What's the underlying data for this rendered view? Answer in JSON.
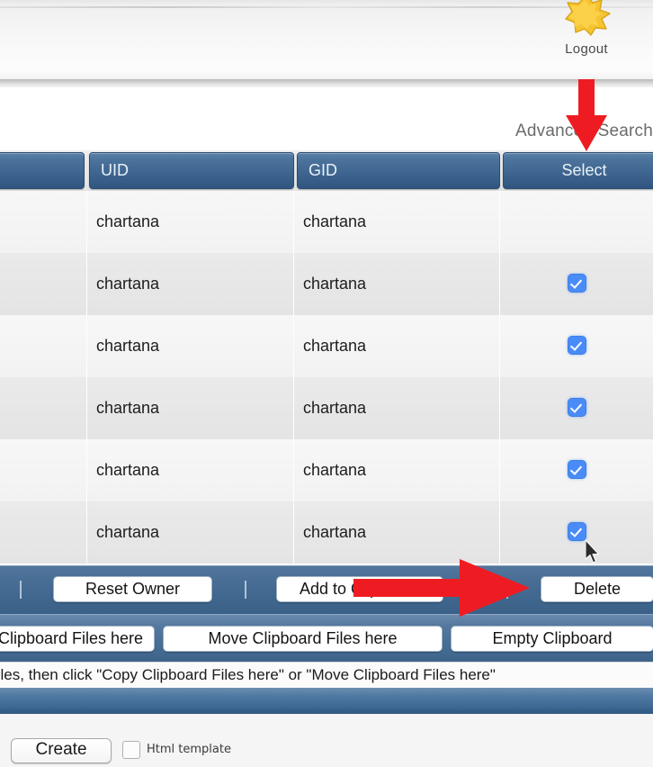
{
  "header": {
    "logout_label": "Logout",
    "logout_icon": "key-star-icon"
  },
  "search": {
    "advanced_search_label": "Advanced Search"
  },
  "table": {
    "columns": [
      "",
      "UID",
      "GID",
      "Select"
    ],
    "rows": [
      {
        "blank": "",
        "uid": "chartana",
        "gid": "chartana",
        "selected": false
      },
      {
        "blank": "",
        "uid": "chartana",
        "gid": "chartana",
        "selected": true
      },
      {
        "blank": "",
        "uid": "chartana",
        "gid": "chartana",
        "selected": true
      },
      {
        "blank": "",
        "uid": "chartana",
        "gid": "chartana",
        "selected": true
      },
      {
        "blank": "",
        "uid": "chartana",
        "gid": "chartana",
        "selected": true
      },
      {
        "blank": "",
        "uid": "chartana",
        "gid": "chartana",
        "selected": true
      }
    ]
  },
  "toolbar_row1": {
    "reset_owner_label": "Reset Owner",
    "add_to_clipboard_label": "Add to Clipboard",
    "delete_label": "Delete"
  },
  "toolbar_row2": {
    "copy_clipboard_label": "Copy Clipboard Files here",
    "move_clipboard_label": "Move Clipboard Files here",
    "empty_clipboard_label": "Empty Clipboard"
  },
  "hint": {
    "text": "files, then click \"Copy Clipboard Files here\" or \"Move Clipboard Files here\""
  },
  "footer": {
    "create_label": "Create",
    "html_template_label": "Html template",
    "html_template_checked": false
  },
  "annotations": {
    "arrow_down": "red-down-arrow-icon",
    "arrow_right": "red-right-arrow-icon",
    "cursor": "mouse-pointer-icon"
  },
  "colors": {
    "header_blue_top": "#5c82a8",
    "header_blue_bottom": "#2f5580",
    "toolbar_blue": "#41688f",
    "checkbox_blue": "#4a8cf7",
    "annotation_red": "#ee1c22"
  }
}
